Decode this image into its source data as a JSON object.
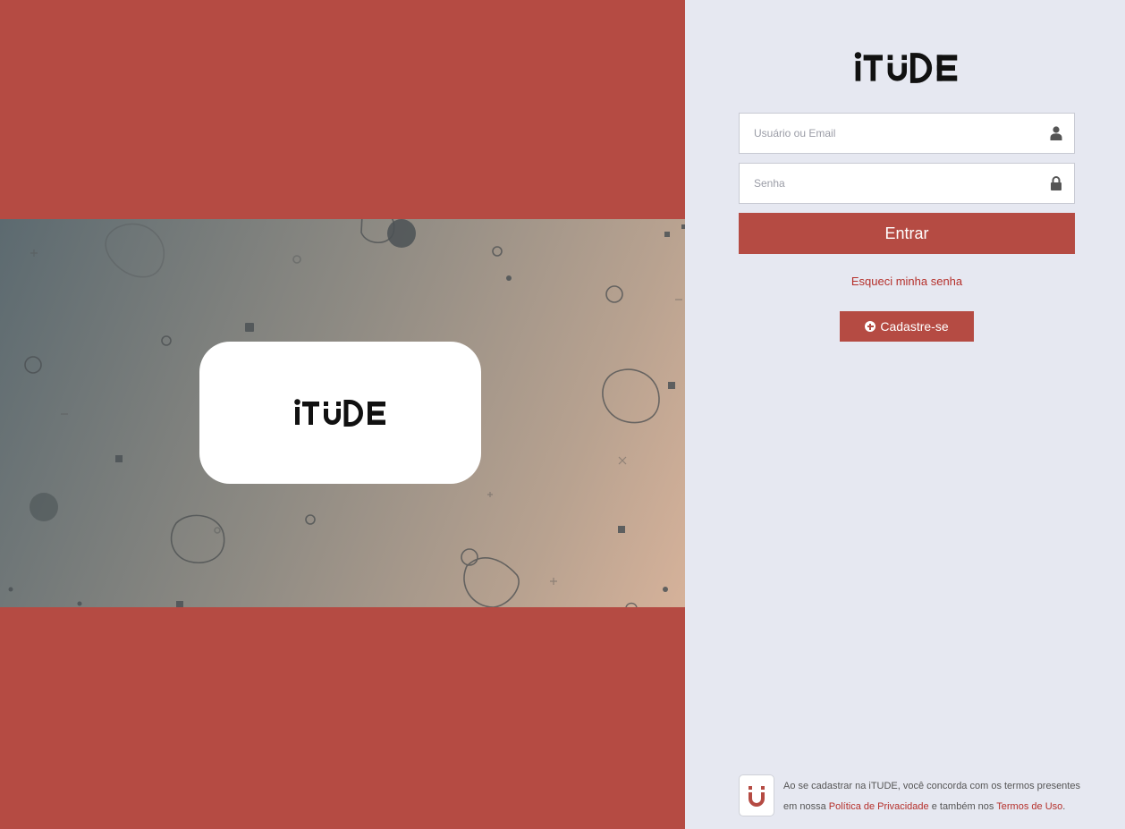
{
  "brand": {
    "name": "iTUDE",
    "accent_color": "#b54b43",
    "link_color": "#b5302b"
  },
  "login": {
    "username_placeholder": "Usuário ou Email",
    "username_icon": "user-icon",
    "password_placeholder": "Senha",
    "password_icon": "lock-icon",
    "submit_label": "Entrar",
    "forgot_label": "Esqueci minha senha",
    "signup_label": "Cadastre-se",
    "signup_icon": "plus-circle-icon"
  },
  "footer": {
    "text_before": "Ao se cadastrar na iTUDE, você concorda com os termos presentes em nossa ",
    "privacy_link": "Política de Privacidade",
    "text_middle": " e também nos ",
    "terms_link": "Termos de Uso",
    "text_after": "."
  }
}
